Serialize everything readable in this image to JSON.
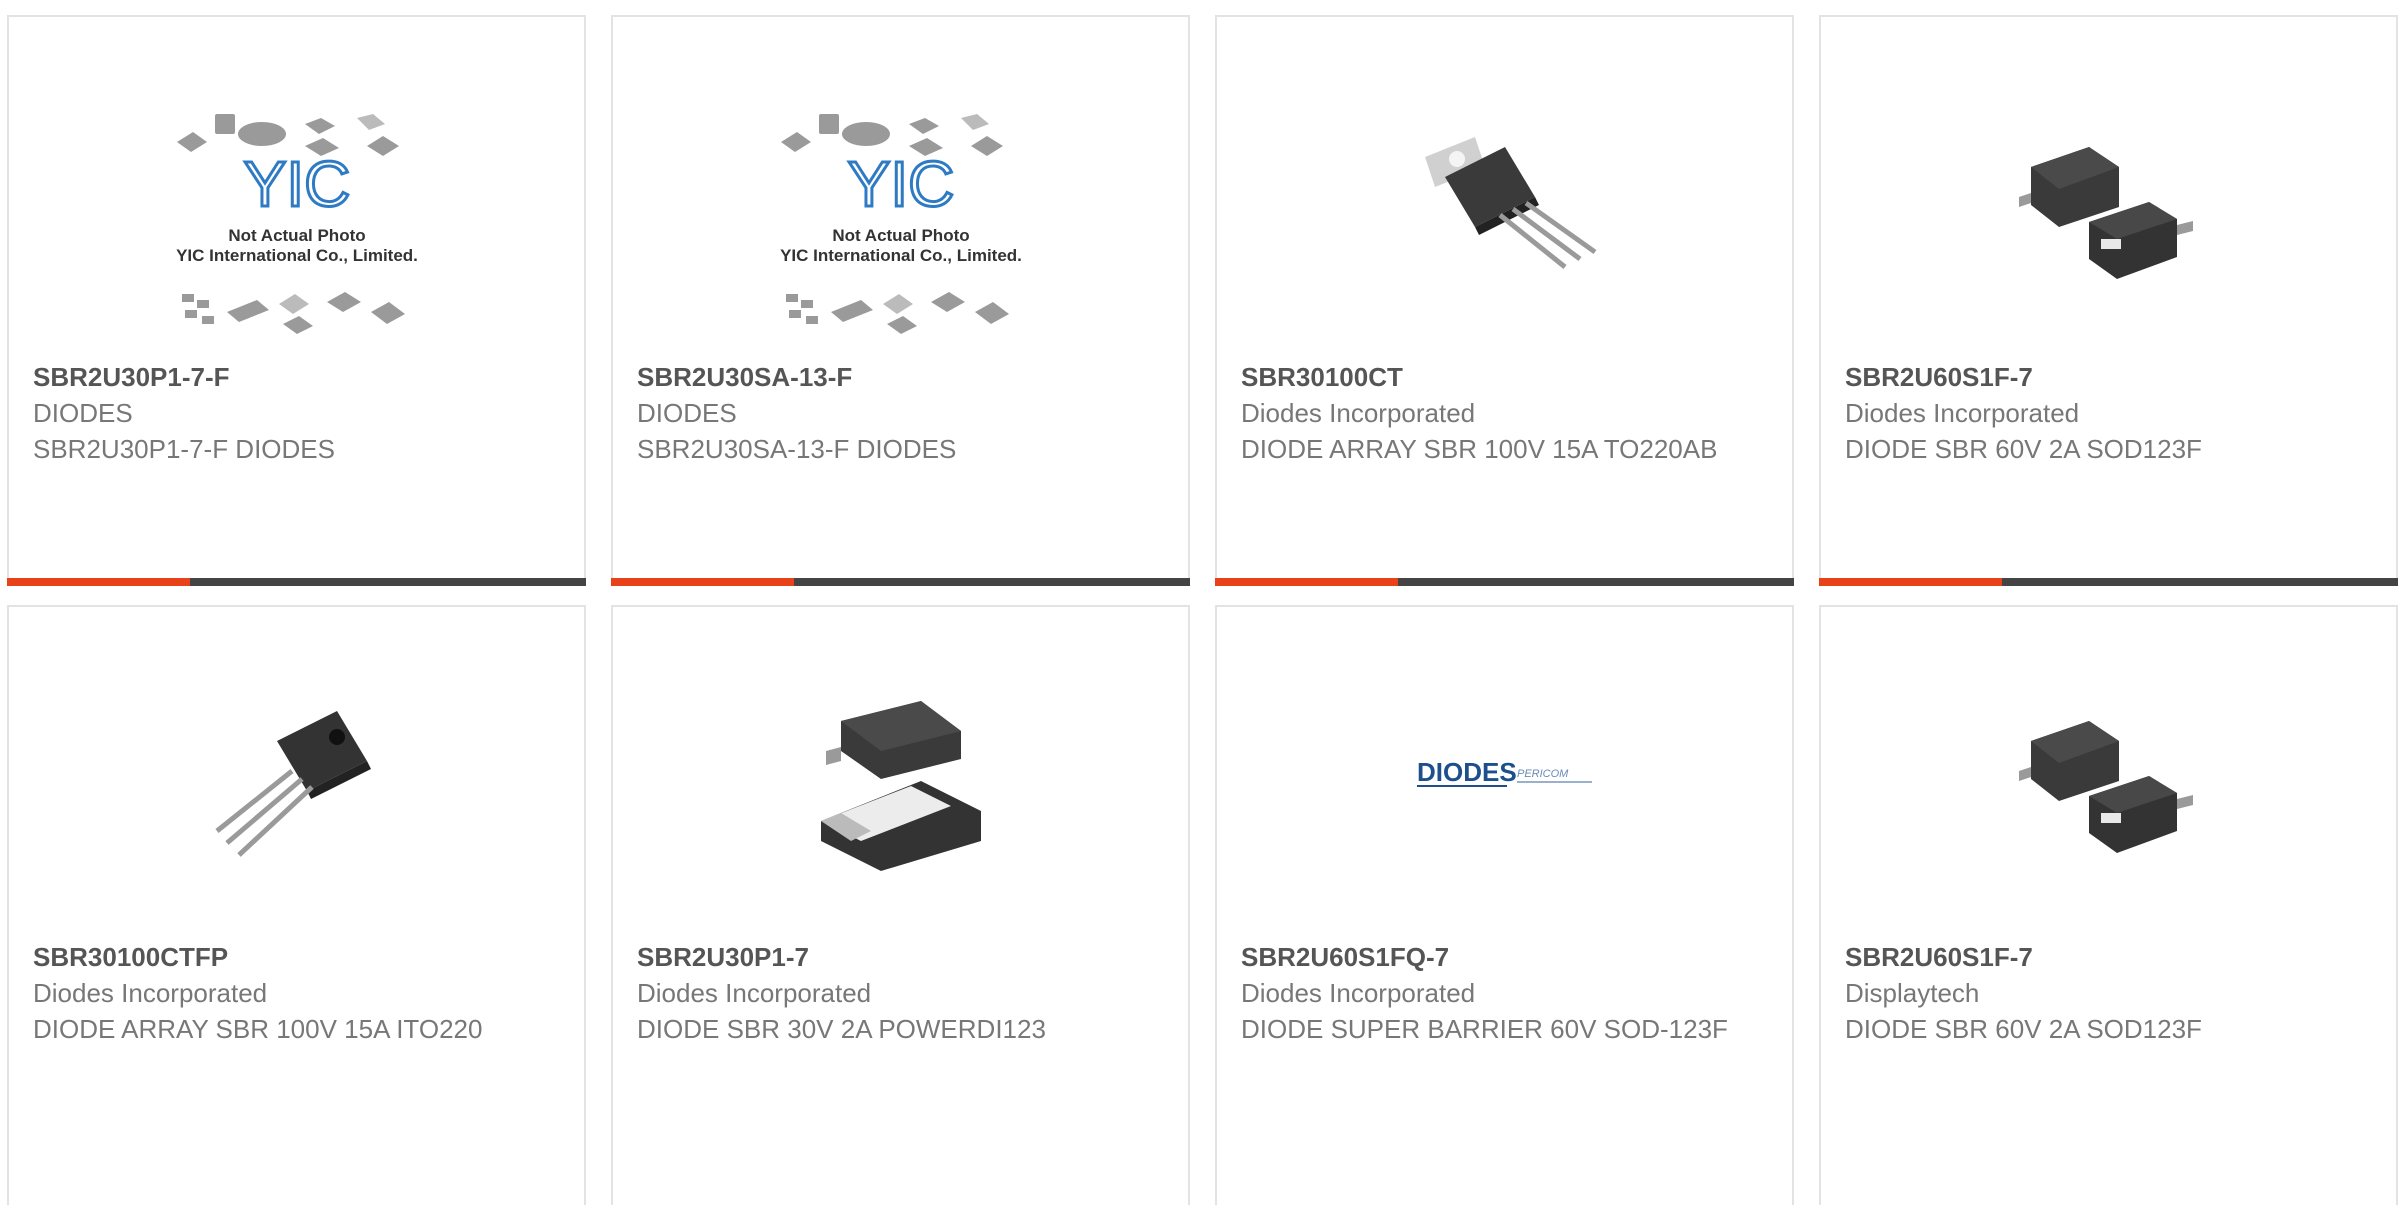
{
  "colors": {
    "accent": "#e8421a",
    "bar": "#444444",
    "border": "#e3e3e3",
    "title": "#555555",
    "text": "#777777"
  },
  "products": [
    {
      "part": "SBR2U30P1-7-F",
      "manufacturer": "DIODES",
      "description": "SBR2U30P1-7-F DIODES",
      "image": "yic-not-actual-photo",
      "image_caption_1": "Not Actual Photo",
      "image_caption_2": "YIC International Co., Limited.",
      "image_logo": "YIC"
    },
    {
      "part": "SBR2U30SA-13-F",
      "manufacturer": "DIODES",
      "description": "SBR2U30SA-13-F DIODES",
      "image": "yic-not-actual-photo",
      "image_caption_1": "Not Actual Photo",
      "image_caption_2": "YIC International Co., Limited.",
      "image_logo": "YIC"
    },
    {
      "part": "SBR30100CT",
      "manufacturer": "Diodes Incorporated",
      "description": "DIODE ARRAY SBR 100V 15A TO220AB",
      "image": "to220-package"
    },
    {
      "part": "SBR2U60S1F-7",
      "manufacturer": "Diodes Incorporated",
      "description": "DIODE SBR 60V 2A SOD123F",
      "image": "sod123f-package"
    },
    {
      "part": "SBR30100CTFP",
      "manufacturer": "Diodes Incorporated",
      "description": "DIODE ARRAY SBR 100V 15A ITO220",
      "image": "ito220-package"
    },
    {
      "part": "SBR2U30P1-7",
      "manufacturer": "Diodes Incorporated",
      "description": "DIODE SBR 30V 2A POWERDI123",
      "image": "powerdi123-package"
    },
    {
      "part": "SBR2U60S1FQ-7",
      "manufacturer": "Diodes Incorporated",
      "description": "DIODE SUPER BARRIER 60V SOD-123F",
      "image": "diodes-pericom-logo",
      "image_logo": "DIODES",
      "image_logo_2": "PERICOM"
    },
    {
      "part": "SBR2U60S1F-7",
      "manufacturer": "Displaytech",
      "description": "DIODE SBR 60V 2A SOD123F",
      "image": "sod123f-package"
    }
  ]
}
